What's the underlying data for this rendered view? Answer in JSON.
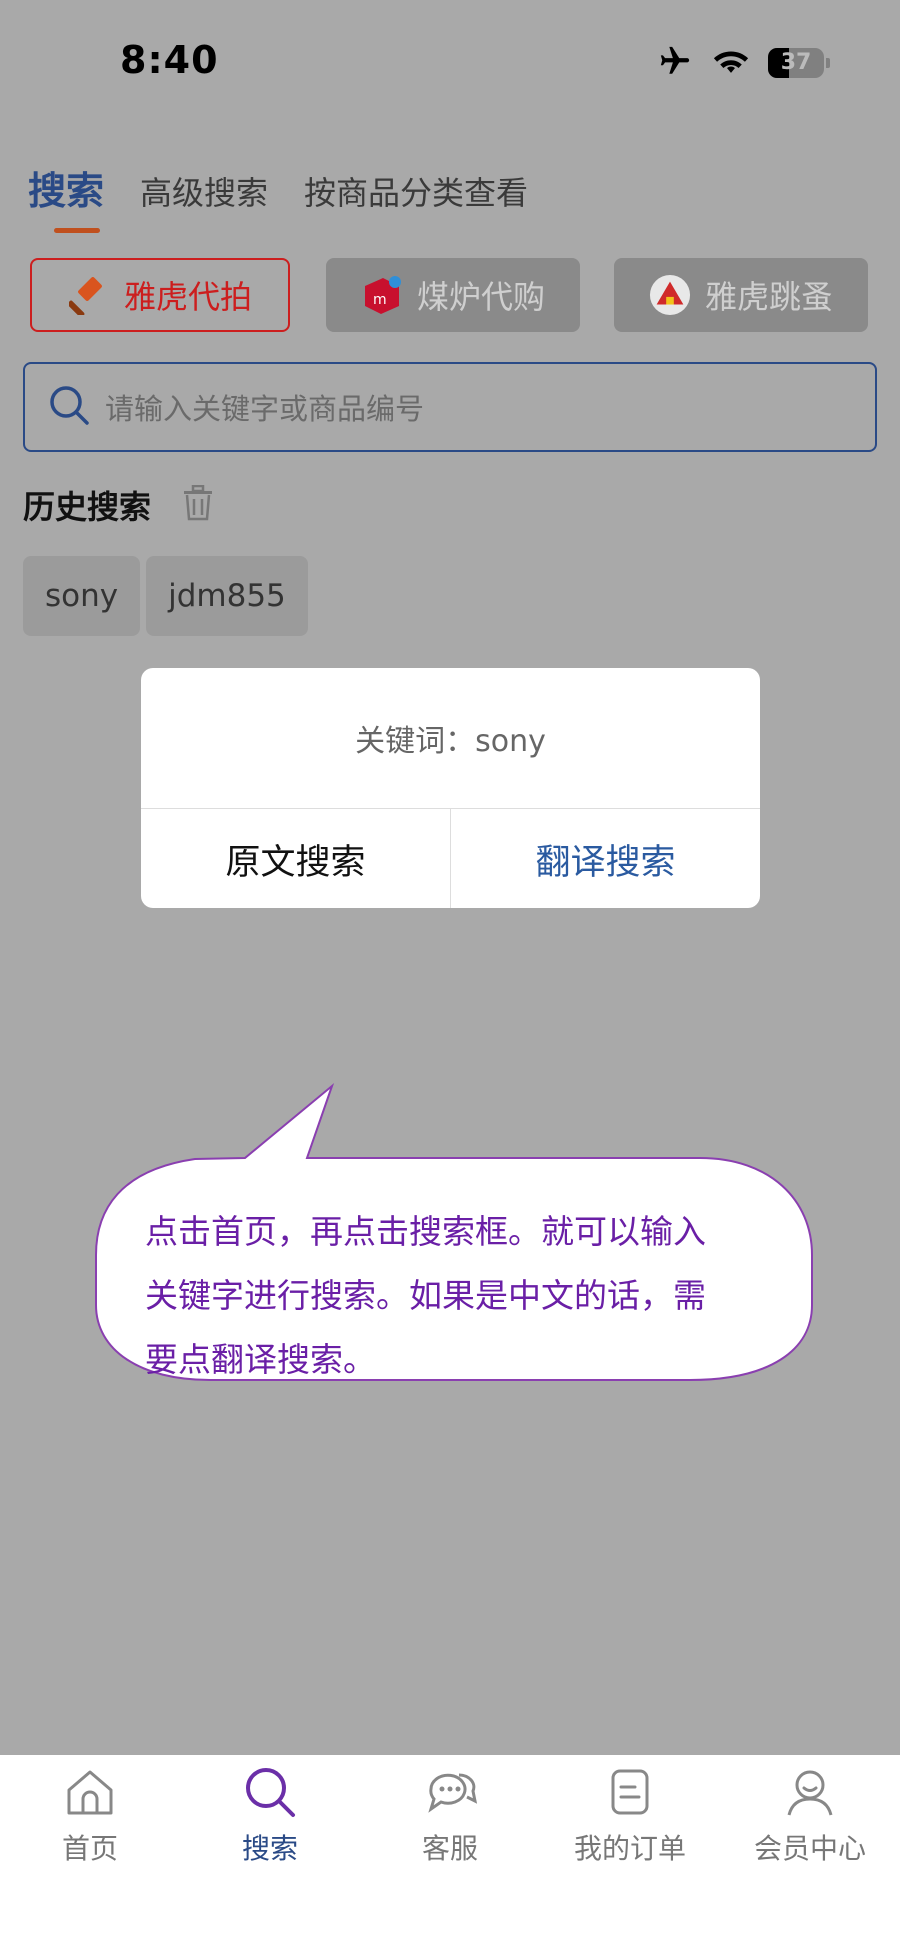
{
  "status_bar": {
    "time": "8:40",
    "battery": "37"
  },
  "tabs": [
    {
      "label": "搜索",
      "active": true
    },
    {
      "label": "高级搜索",
      "active": false
    },
    {
      "label": "按商品分类查看",
      "active": false
    }
  ],
  "sources": [
    {
      "label": "雅虎代拍",
      "icon": "gavel-icon",
      "active": true
    },
    {
      "label": "煤炉代购",
      "icon": "mercari-icon",
      "active": false
    },
    {
      "label": "雅虎跳蚤",
      "icon": "circus-tent-icon",
      "active": false
    }
  ],
  "search": {
    "placeholder": "请输入关键字或商品编号"
  },
  "history": {
    "title": "历史搜索",
    "items": [
      "sony",
      "jdm855"
    ]
  },
  "dialog": {
    "keyword_text": "关键词：sony",
    "original_search": "原文搜索",
    "translate_search": "翻译搜索"
  },
  "tip": {
    "lines": [
      "点击首页，再点击搜索框。就可以输入",
      "关键字进行搜索。如果是中文的话，需",
      "要点翻译搜索。"
    ]
  },
  "tabbar": [
    {
      "label": "首页",
      "icon": "home-icon"
    },
    {
      "label": "搜索",
      "icon": "search-icon",
      "active": true
    },
    {
      "label": "客服",
      "icon": "chat-icon"
    },
    {
      "label": "我的订单",
      "icon": "orders-icon"
    },
    {
      "label": "会员中心",
      "icon": "user-icon"
    }
  ],
  "colors": {
    "accent": "#2a4a86",
    "red": "#cc1e1e",
    "tip": "#6a1fa6",
    "overlay": "#a9a9a9"
  }
}
